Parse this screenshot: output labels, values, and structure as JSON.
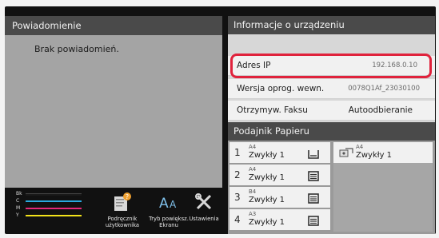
{
  "notifications": {
    "title": "Powiadomienie",
    "empty_text": "Brak powiadomień."
  },
  "toner": {
    "labels": [
      "Bk",
      "C",
      "M",
      "Y"
    ],
    "colors": [
      "#1a1a1a",
      "#29a9e0",
      "#e5287a",
      "#f2e21a"
    ]
  },
  "bottom_icons": [
    {
      "label1": "Podręcznik",
      "label2": "użytkownika",
      "icon": "manual-icon"
    },
    {
      "label1": "Tryb powiększ.",
      "label2": "Ekranu",
      "icon": "zoom-text-icon"
    },
    {
      "label1": "Ustawienia",
      "label2": "",
      "icon": "settings-tools-icon"
    }
  ],
  "device_info": {
    "title": "Informacje o urządzeniu",
    "rows": [
      {
        "key": "Adres IP",
        "value": "192.168.0.10"
      },
      {
        "key": "Wersja oprog. wewn.",
        "value": "0078Q1Af_23030100"
      },
      {
        "key": "Otrzymyw. Faksu",
        "value": "Autoodbieranie"
      }
    ],
    "highlight_color": "#e0223c"
  },
  "paper_tray": {
    "title": "Podajnik Papieru",
    "trays": [
      {
        "num": "1",
        "size": "A4",
        "type": "Zwykły 1",
        "icon": "tray-open-icon"
      },
      {
        "num": "2",
        "size": "A4",
        "type": "Zwykły 1",
        "icon": "tray-full-icon"
      },
      {
        "num": "3",
        "size": "B4",
        "type": "Zwykły 1",
        "icon": "tray-full-icon"
      },
      {
        "num": "4",
        "size": "A3",
        "type": "Zwykły 1",
        "icon": "tray-full-icon"
      }
    ],
    "bypass": {
      "size": "A4",
      "type": "Zwykły 1",
      "icon": "bypass-tray-icon"
    }
  }
}
